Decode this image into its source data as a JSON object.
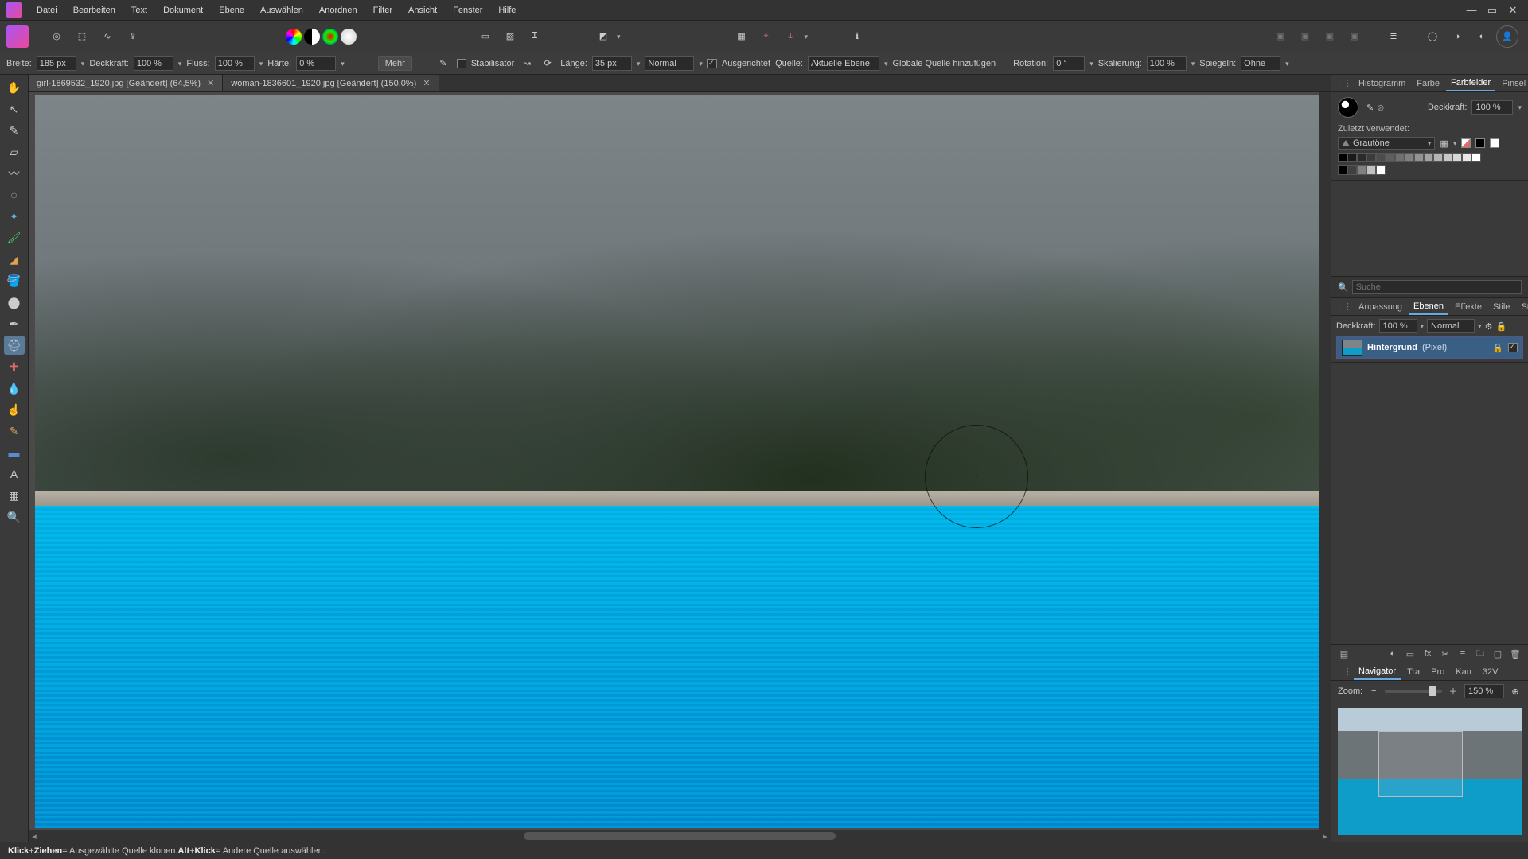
{
  "menu": [
    "Datei",
    "Bearbeiten",
    "Text",
    "Dokument",
    "Ebene",
    "Auswählen",
    "Anordnen",
    "Filter",
    "Ansicht",
    "Fenster",
    "Hilfe"
  ],
  "tabs": [
    {
      "label": "girl-1869532_1920.jpg [Geändert] (64,5%)",
      "active": true
    },
    {
      "label": "woman-1836601_1920.jpg [Geändert] (150,0%)",
      "active": false
    }
  ],
  "context": {
    "width_label": "Breite:",
    "width": "185 px",
    "opacity_label": "Deckkraft:",
    "opacity": "100 %",
    "flow_label": "Fluss:",
    "flow": "100 %",
    "hardness_label": "Härte:",
    "hardness": "0 %",
    "more": "Mehr",
    "stabiliser_label": "Stabilisator",
    "length_label": "Länge:",
    "length": "35 px",
    "blend": "Normal",
    "aligned_label": "Ausgerichtet",
    "source_label": "Quelle:",
    "source_value": "Aktuelle Ebene",
    "add_global": "Globale Quelle hinzufügen",
    "rotation_label": "Rotation:",
    "rotation": "0 °",
    "scale_label": "Skalierung:",
    "scale": "100 %",
    "mirror_label": "Spiegeln:",
    "mirror_value": "Ohne"
  },
  "right": {
    "tabs_top": [
      "Histogramm",
      "Farbe",
      "Farbfelder",
      "Pinsel"
    ],
    "active_top": "Farbfelder",
    "opacity_label": "Deckkraft:",
    "opacity_value": "100 %",
    "recent_label": "Zuletzt verwendet:",
    "gradient_name": "Grautöne",
    "tabs_mid": [
      "Anpassung",
      "Ebenen",
      "Effekte",
      "Stile",
      "Stock"
    ],
    "active_mid": "Ebenen",
    "layer_opacity_label": "Deckkraft:",
    "layer_opacity": "100 %",
    "layer_blend": "Normal",
    "layer_name": "Hintergrund",
    "layer_type": "(Pixel)",
    "search_placeholder": "Suche",
    "tabs_nav": [
      "Navigator",
      "Tra",
      "Pro",
      "Kan",
      "32V"
    ],
    "active_nav": "Navigator",
    "zoom_label": "Zoom:",
    "zoom_value": "150 %"
  },
  "status": {
    "a": "Klick",
    "b": "+",
    "c": "Ziehen",
    "d": " = Ausgewählte Quelle klonen. ",
    "e": "Alt",
    "f": "+",
    "g": "Klick",
    "h": " = Andere Quelle auswählen."
  },
  "grayscale": [
    "#000000",
    "#1a1a1a",
    "#2b2b2b",
    "#3c3c3c",
    "#4d4d4d",
    "#5e5e5e",
    "#707070",
    "#818181",
    "#929292",
    "#a3a3a3",
    "#b4b4b4",
    "#c6c6c6",
    "#d7d7d7",
    "#e8e8e8",
    "#ffffff"
  ],
  "grayscale2": [
    "#000000",
    "#404040",
    "#808080",
    "#c0c0c0",
    "#ffffff"
  ]
}
